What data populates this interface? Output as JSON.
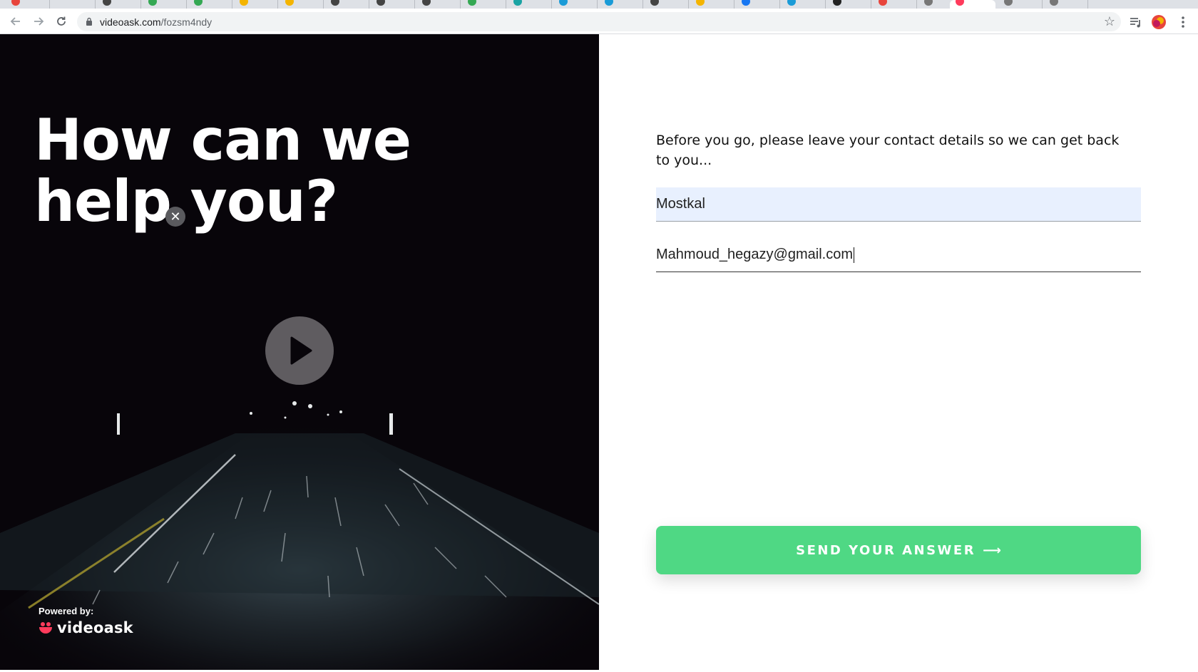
{
  "browser": {
    "url_host": "videoask.com",
    "url_path": "/fozsm4ndy"
  },
  "video": {
    "headline": "How can we help you?",
    "powered_label": "Powered by:",
    "brand_name": "videoask"
  },
  "form": {
    "prompt": "Before you go, please leave your contact details so we can get back to you...",
    "name_value": "Mostkal",
    "email_value": "Mahmoud_hegazy@gmail.com",
    "send_label": "SEND YOUR ANSWER",
    "send_arrow": "⟶"
  },
  "colors": {
    "accent_green": "#4fd884",
    "autofill_bg": "#e8f0fe",
    "video_bg": "#08050a"
  }
}
